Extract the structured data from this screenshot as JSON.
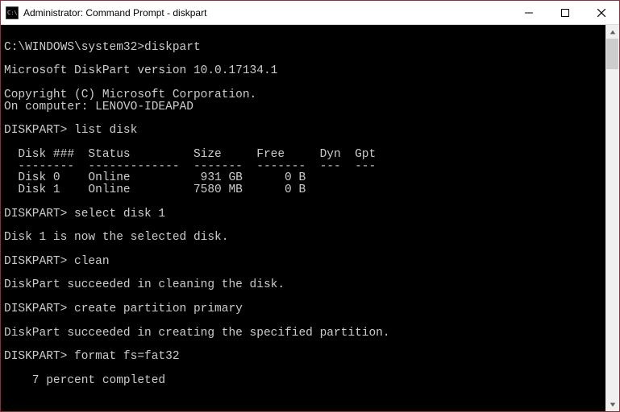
{
  "window": {
    "title": "Administrator: Command Prompt - diskpart"
  },
  "terminal": {
    "lines": [
      "",
      "C:\\WINDOWS\\system32>diskpart",
      "",
      "Microsoft DiskPart version 10.0.17134.1",
      "",
      "Copyright (C) Microsoft Corporation.",
      "On computer: LENOVO-IDEAPAD",
      "",
      "DISKPART> list disk",
      "",
      "  Disk ###  Status         Size     Free     Dyn  Gpt",
      "  --------  -------------  -------  -------  ---  ---",
      "  Disk 0    Online          931 GB      0 B",
      "  Disk 1    Online         7580 MB      0 B",
      "",
      "DISKPART> select disk 1",
      "",
      "Disk 1 is now the selected disk.",
      "",
      "DISKPART> clean",
      "",
      "DiskPart succeeded in cleaning the disk.",
      "",
      "DISKPART> create partition primary",
      "",
      "DiskPart succeeded in creating the specified partition.",
      "",
      "DISKPART> format fs=fat32",
      "",
      "    7 percent completed"
    ]
  }
}
